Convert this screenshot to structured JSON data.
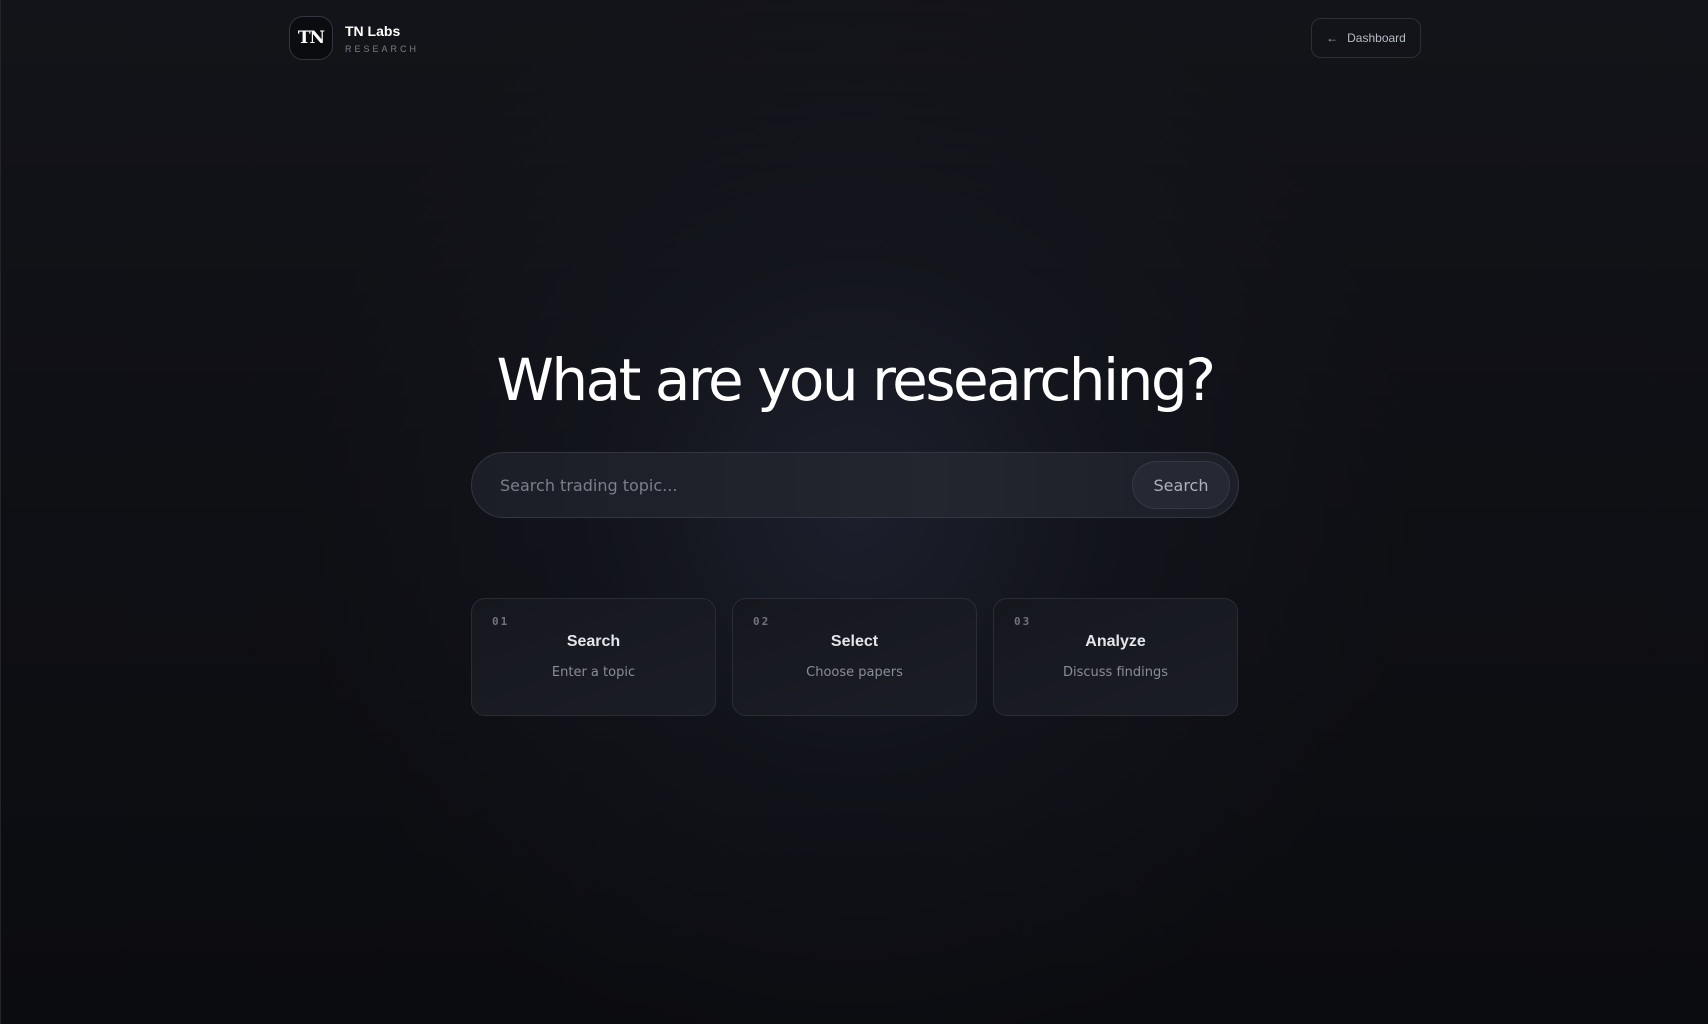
{
  "header": {
    "logo_text": "TN",
    "brand_name": "TN Labs",
    "brand_sub": "RESEARCH",
    "dashboard_icon": "arrow-left-icon",
    "dashboard_label": "Dashboard"
  },
  "hero": {
    "title": "What are you researching?"
  },
  "search": {
    "value": "",
    "placeholder": "Search trading topic...",
    "button_label": "Search"
  },
  "steps": [
    {
      "number": "01",
      "title": "Search",
      "description": "Enter a topic"
    },
    {
      "number": "02",
      "title": "Select",
      "description": "Choose papers"
    },
    {
      "number": "03",
      "title": "Analyze",
      "description": "Discuss findings"
    }
  ],
  "colors": {
    "background": "#0c0d11",
    "card": "#1a1b22",
    "border": "#2c2e37",
    "text_primary": "#ffffff",
    "text_muted": "#8a8d98"
  }
}
